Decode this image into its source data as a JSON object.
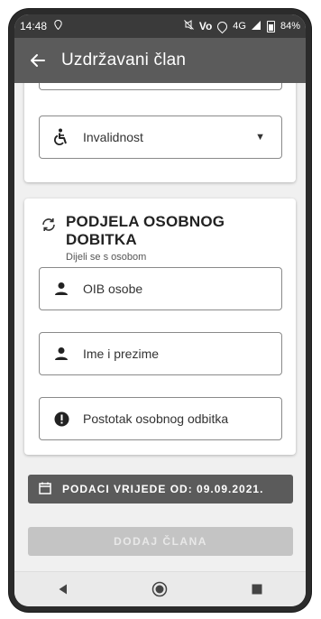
{
  "status_bar": {
    "time": "14:48",
    "network": "4G",
    "volte": "Vo",
    "battery": "84%"
  },
  "app_bar": {
    "title": "Uzdržavani član"
  },
  "disability_field": {
    "label": "Invalidnost"
  },
  "share_section": {
    "title": "PODJELA OSOBNOG DOBITKA",
    "subtitle": "Dijeli se s osobom",
    "oib_label": "OIB osobe",
    "name_label": "Ime i prezime",
    "percent_label": "Postotak osobnog odbitka"
  },
  "validity_bar": {
    "text": "PODACI VRIJEDE OD: 09.09.2021."
  },
  "add_button": {
    "label": "DODAJ ČLANA"
  },
  "colors": {
    "app_bar": "#5b5b5b",
    "status_bar": "#3a3a3a",
    "button_disabled": "#c4c4c4"
  }
}
